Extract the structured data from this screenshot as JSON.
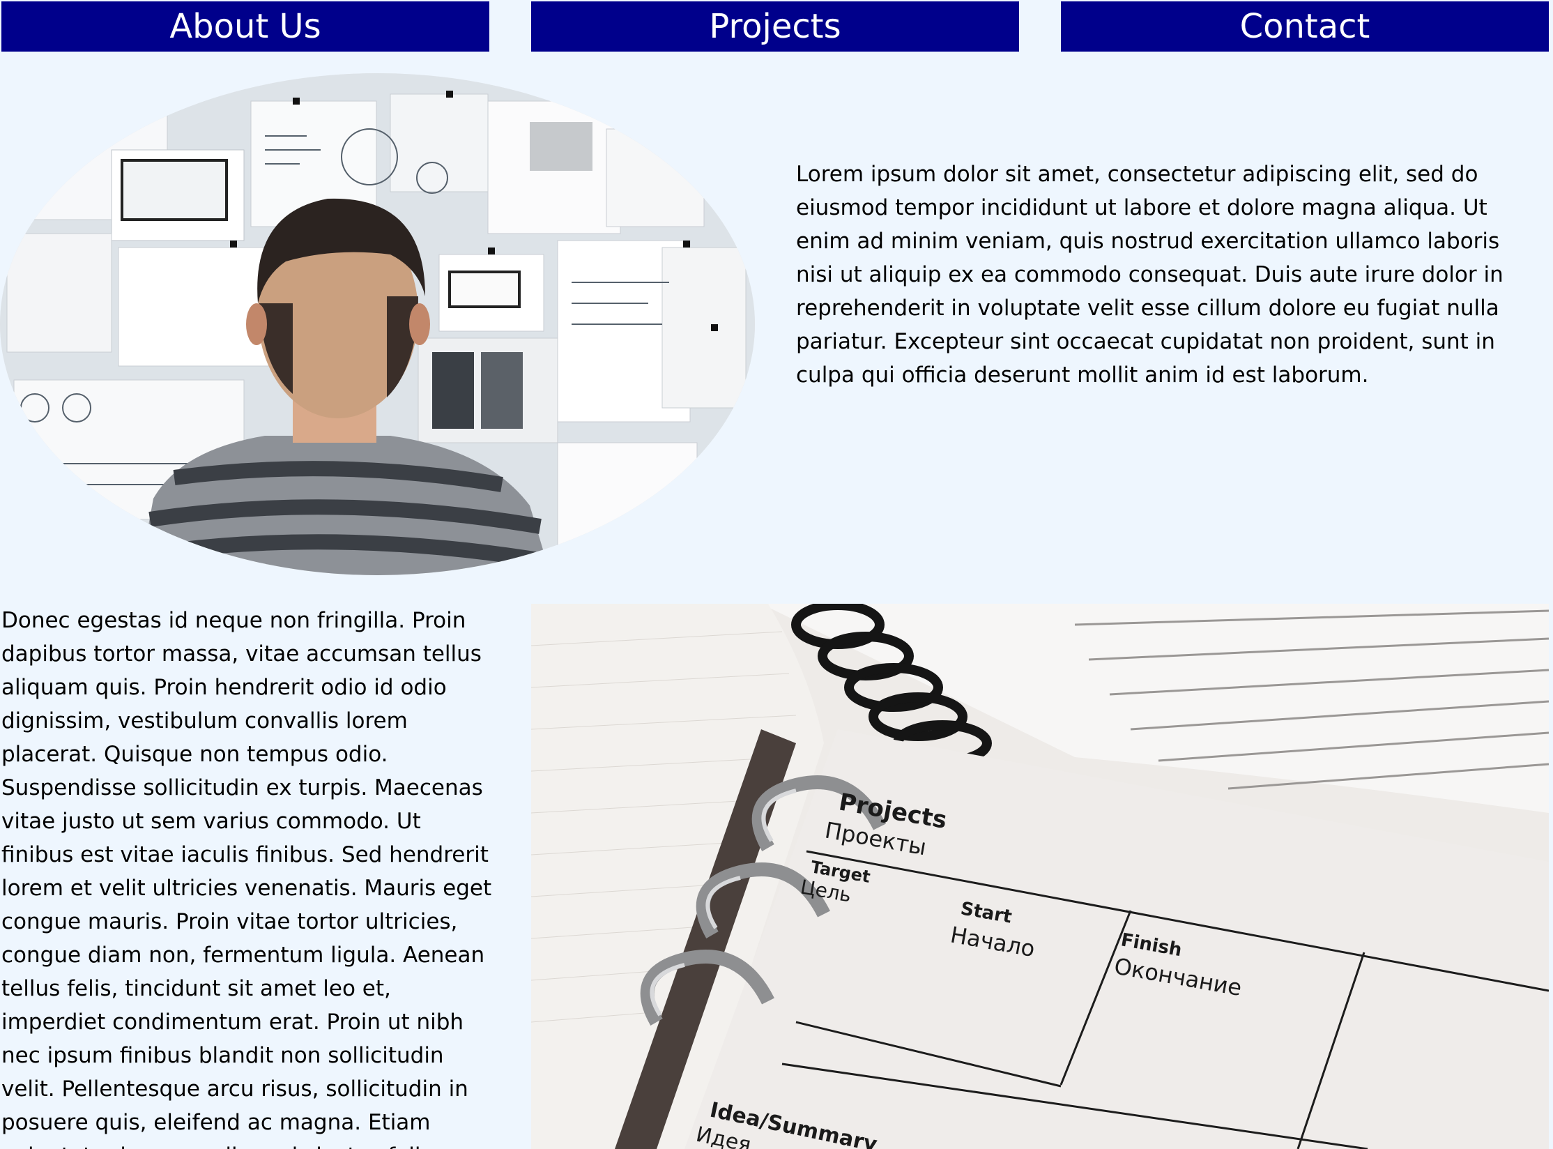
{
  "nav": {
    "about_label": "About Us",
    "projects_label": "Projects",
    "contact_label": "Contact"
  },
  "intro": {
    "text": "Lorem ipsum dolor sit amet, consectetur adipiscing elit, sed do eiusmod tempor incididunt ut labore et dolore magna aliqua. Ut enim ad minim veniam, quis nostrud exercitation ullamco laboris nisi ut aliquip ex ea commodo consequat. Duis aute irure dolor in reprehenderit in voluptate velit esse cillum dolore eu fugiat nulla pariatur. Excepteur sint occaecat cupidatat non proident, sunt in culpa qui officia deserunt mollit anim id est laborum."
  },
  "body": {
    "text": "Donec egestas id neque non fringilla. Proin dapibus tortor massa, vitae accumsan tellus aliquam quis. Proin hendrerit odio id odio dignissim, vestibulum convallis lorem placerat. Quisque non tempus odio. Suspendisse sollicitudin ex turpis. Maecenas vitae justo ut sem varius commodo. Ut finibus est vitae iaculis finibus. Sed hendrerit lorem et velit ultricies venenatis. Mauris eget congue mauris. Proin vitae tortor ultricies, congue diam non, fermentum ligula. Aenean tellus felis, tincidunt sit amet leo et, imperdiet condimentum erat. Proin ut nibh nec ipsum finibus blandit non sollicitudin velit. Pellentesque arcu risus, sollicitudin in posuere quis, eleifend ac magna. Etiam vulputate rhoncus odio, quis luctus felis"
  },
  "planner": {
    "title_en": "Projects",
    "title_ru": "Проекты",
    "target_en": "Target",
    "target_ru": "Цель",
    "start_en": "Start",
    "start_ru": "Начало",
    "finish_en": "Finish",
    "finish_ru": "Окончание",
    "idea_en": "Idea/Summary",
    "idea_ru": "Идея"
  },
  "colors": {
    "page_bg": "#eef6fe",
    "nav_bg": "#00008b",
    "nav_text": "#ffffff"
  }
}
